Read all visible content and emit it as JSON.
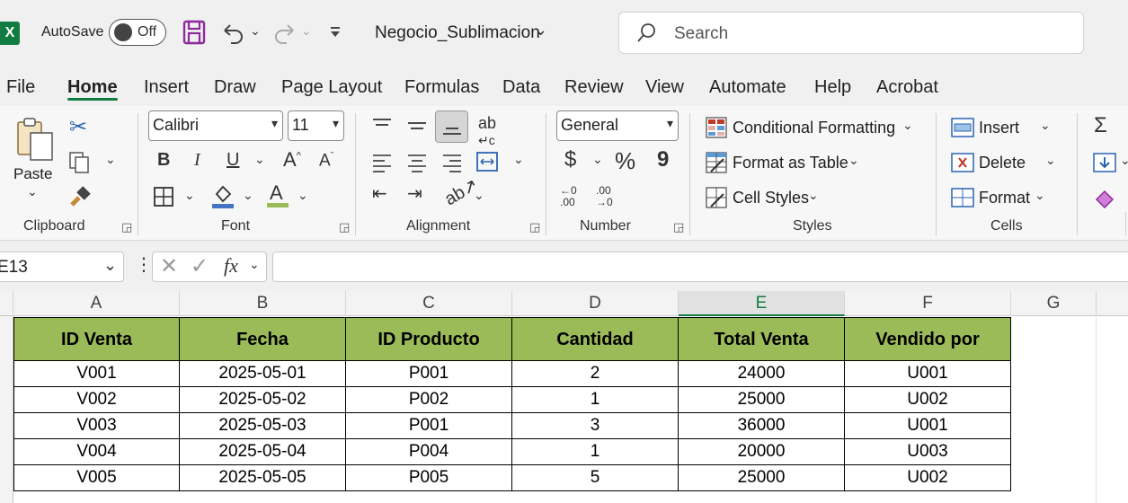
{
  "title_bar": {
    "autosave_label": "AutoSave",
    "autosave_state": "Off",
    "file_name": "Negocio_Sublimacion",
    "search_placeholder": "Search"
  },
  "ribbon_tabs": [
    "File",
    "Home",
    "Insert",
    "Draw",
    "Page Layout",
    "Formulas",
    "Data",
    "Review",
    "View",
    "Automate",
    "Help",
    "Acrobat"
  ],
  "active_tab": "Home",
  "clipboard": {
    "paste_label": "Paste",
    "group_label": "Clipboard"
  },
  "font": {
    "family": "Calibri",
    "size": "11",
    "group_label": "Font",
    "bold": "B",
    "italic": "I",
    "underline": "U"
  },
  "alignment": {
    "group_label": "Alignment"
  },
  "number": {
    "format": "General",
    "group_label": "Number",
    "currency": "$",
    "percent": "%",
    "comma": "9",
    "increase_decimal": "←0 .00",
    "decrease_decimal": ".00 →0"
  },
  "styles": {
    "conditional_formatting": "Conditional Formatting",
    "format_as_table": "Format as Table",
    "cell_styles": "Cell Styles",
    "group_label": "Styles"
  },
  "cells": {
    "insert": "Insert",
    "delete": "Delete",
    "format": "Format",
    "group_label": "Cells"
  },
  "formula_bar": {
    "name_box": "E13",
    "fx": "fx",
    "value": ""
  },
  "columns": [
    "A",
    "B",
    "C",
    "D",
    "E",
    "F",
    "G"
  ],
  "selected_column": "E",
  "table": {
    "headers": [
      "ID Venta",
      "Fecha",
      "ID Producto",
      "Cantidad",
      "Total Venta",
      "Vendido por"
    ],
    "rows": [
      [
        "V001",
        "2025-05-01",
        "P001",
        "2",
        "24000",
        "U001"
      ],
      [
        "V002",
        "2025-05-02",
        "P002",
        "1",
        "25000",
        "U002"
      ],
      [
        "V003",
        "2025-05-03",
        "P001",
        "3",
        "36000",
        "U001"
      ],
      [
        "V004",
        "2025-05-04",
        "P004",
        "1",
        "20000",
        "U003"
      ],
      [
        "V005",
        "2025-05-05",
        "P005",
        "5",
        "25000",
        "U002"
      ]
    ]
  },
  "colors": {
    "accent": "#107c41",
    "header_fill": "#9bbb59"
  }
}
